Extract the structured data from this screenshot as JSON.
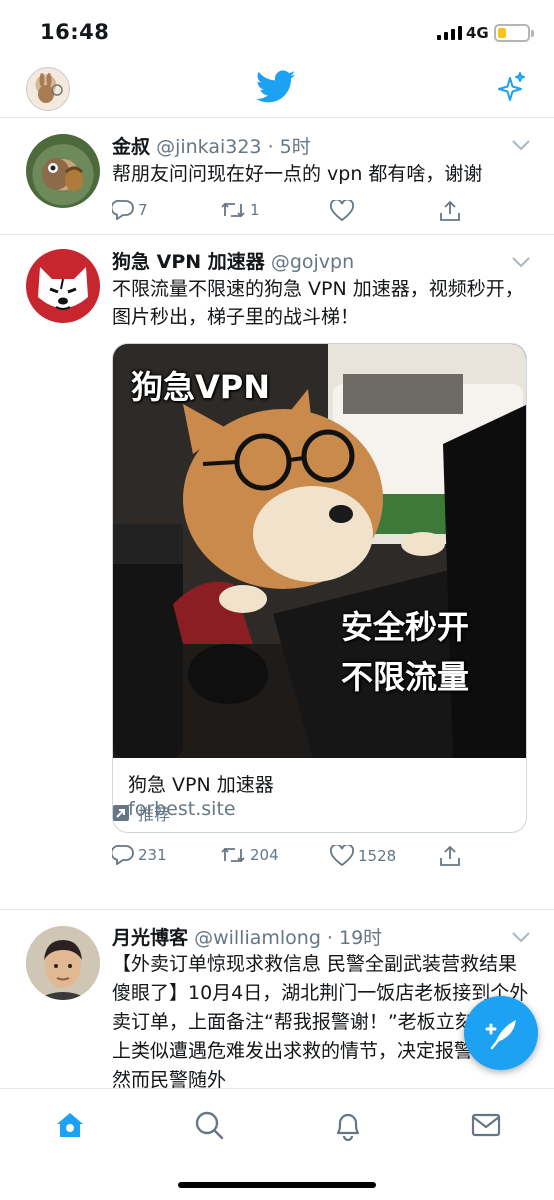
{
  "status_bar": {
    "time": "16:48",
    "network": "4G",
    "battery_level": 0.3,
    "battery_color": "#f5c518"
  },
  "nav": {
    "profile_icon": "avatar",
    "logo_icon": "twitter-bird-icon",
    "sparkle_icon": "sparkle-icon",
    "accent": "#1da1f2"
  },
  "tweets": [
    {
      "name": "金叔",
      "handle": "@jinkai323",
      "time": "· 5时",
      "text": "帮朋友问问现在好一点的 vpn 都有啥，谢谢",
      "replies": "7",
      "retweets": "1",
      "likes": "",
      "caret_icon": "chevron-down-icon"
    },
    {
      "name": "狗急 VPN 加速器",
      "handle": "@gojvpn",
      "time": "",
      "text": "不限流量不限速的狗急 VPN 加速器，视频秒开，图片秒出，梯子里的战斗梯！",
      "card": {
        "overlay_top": "狗急VPN",
        "overlay_line1": "安全秒开",
        "overlay_line2": "不限流量",
        "title": "狗急 VPN 加速器",
        "domain": "forbest.site"
      },
      "replies": "231",
      "retweets": "204",
      "likes": "1528",
      "promoted_label": "推荐"
    },
    {
      "name": "月光博客",
      "handle": "@williamlong",
      "time": "· 19时",
      "text": "【外卖订单惊现求救信息 民警全副武装营救结果傻眼了】10月4日，湖北荆门一饭店老板接到个外卖订单，上面备注“帮我报警谢！”老板立刻想到网上类似遭遇危难发出求救的情节，决定报警求助。然而民警随外"
    }
  ],
  "tabbar": {
    "tabs": [
      "home-icon",
      "search-icon",
      "notifications-icon",
      "messages-icon"
    ],
    "active": "home-icon"
  },
  "compose_icon": "compose-tweet-icon"
}
